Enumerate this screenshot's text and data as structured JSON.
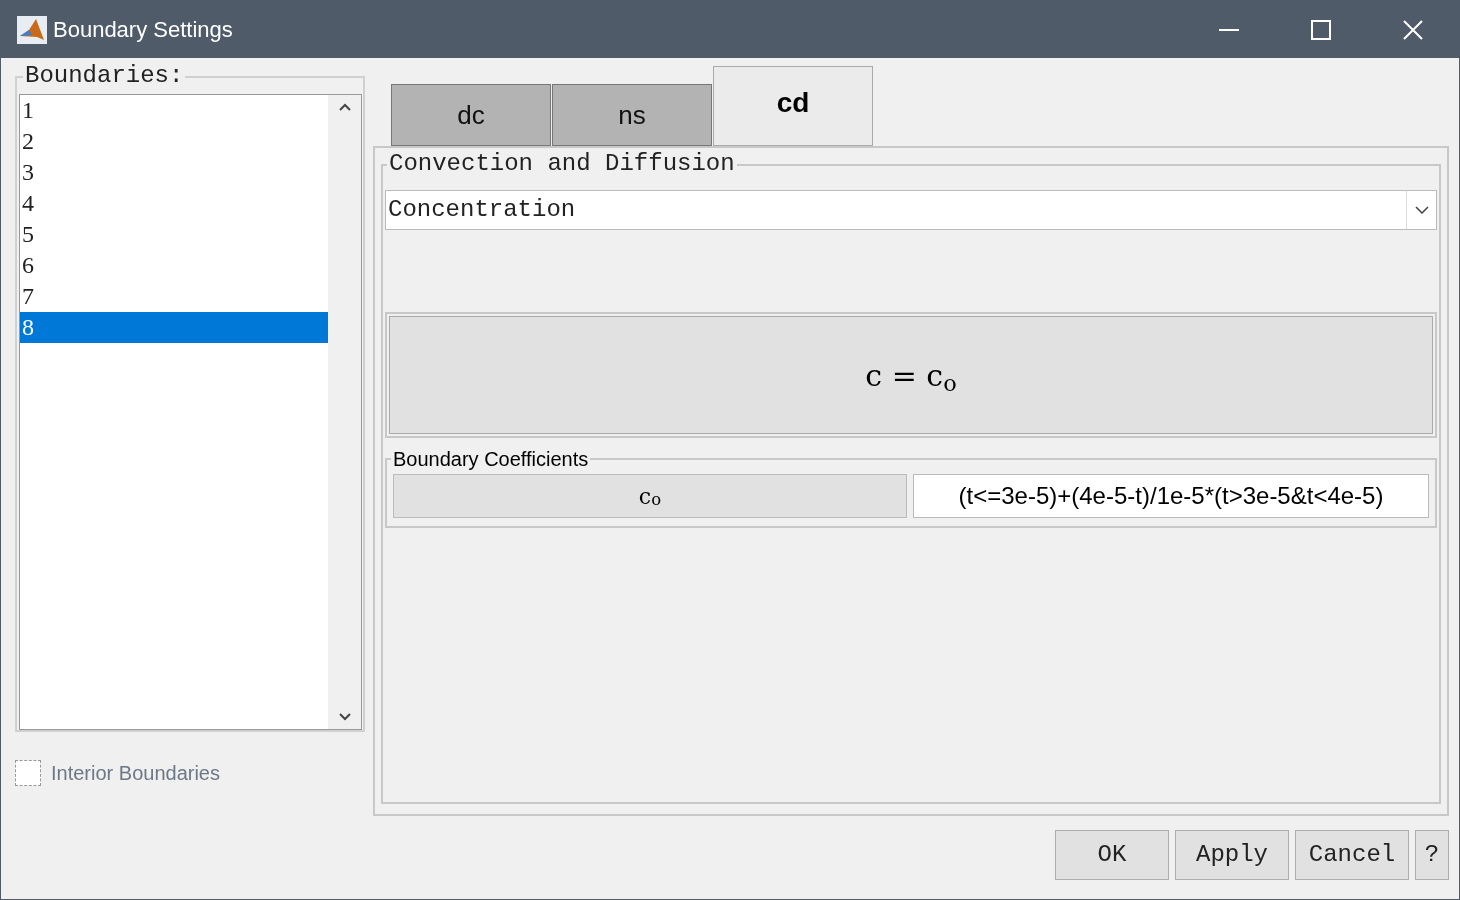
{
  "window": {
    "title": "Boundary Settings"
  },
  "boundaries": {
    "label": "Boundaries:",
    "items": [
      {
        "label": "1",
        "selected": false
      },
      {
        "label": "2",
        "selected": false
      },
      {
        "label": "3",
        "selected": false
      },
      {
        "label": "4",
        "selected": false
      },
      {
        "label": "5",
        "selected": false
      },
      {
        "label": "6",
        "selected": false
      },
      {
        "label": "7",
        "selected": false
      },
      {
        "label": "8",
        "selected": true
      }
    ]
  },
  "interior_boundaries": {
    "label": "Interior Boundaries",
    "checked": false,
    "disabled": true
  },
  "tabs": [
    {
      "label": "dc",
      "selected": false
    },
    {
      "label": "ns",
      "selected": false
    },
    {
      "label": "cd",
      "selected": true
    }
  ],
  "group": {
    "title": "Convection and Diffusion",
    "dropdown": {
      "value": "Concentration"
    },
    "equation": "c = c$_{o}$",
    "coefficients": {
      "title": "Boundary Coefficients",
      "rows": [
        {
          "name": "c$_{o}$",
          "value": "(t<=3e-5)+(4e-5-t)/1e-5*(t>3e-5&t<4e-5)"
        }
      ]
    }
  },
  "buttons": [
    "OK",
    "Apply",
    "Cancel",
    "?"
  ]
}
